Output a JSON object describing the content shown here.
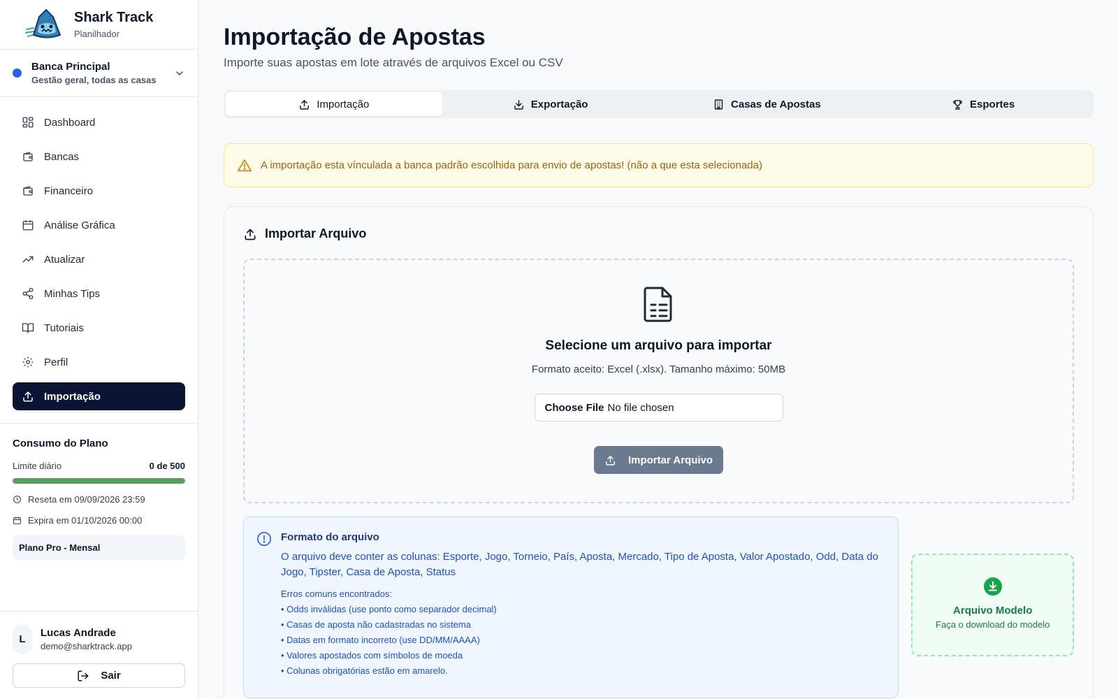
{
  "brand": {
    "title": "Shark Track",
    "subtitle": "Planilhador"
  },
  "bank": {
    "name": "Banca Principal",
    "description": "Gestão geral, todas as casas",
    "dot_color": "#2563eb"
  },
  "nav": [
    {
      "label": "Dashboard",
      "icon": "dashboard-grid-icon"
    },
    {
      "label": "Bancas",
      "icon": "wallet-icon"
    },
    {
      "label": "Financeiro",
      "icon": "wallet-icon"
    },
    {
      "label": "Análise Gráfica",
      "icon": "calendar-icon"
    },
    {
      "label": "Atualizar",
      "icon": "trending-up-icon"
    },
    {
      "label": "Minhas Tips",
      "icon": "share-icon"
    },
    {
      "label": "Tutoriais",
      "icon": "book-open-icon"
    },
    {
      "label": "Perfil",
      "icon": "gear-icon"
    },
    {
      "label": "Importação",
      "icon": "upload-icon",
      "active": true
    }
  ],
  "plan": {
    "title": "Consumo do Plano",
    "limit_label": "Limite diário",
    "limit_value": "0 de 500",
    "usage_fraction": 0,
    "bar_color": "#5b9e5b",
    "reset_text": "Reseta em 09/09/2026 23:59",
    "expire_text": "Expira em 01/10/2026 00:00",
    "plan_name": "Plano Pro - Mensal"
  },
  "user": {
    "initial": "L",
    "name": "Lucas Andrade",
    "email": "demo@sharktrack.app",
    "logout_label": "Sair"
  },
  "page": {
    "title": "Importação de Apostas",
    "subtitle": "Importe suas apostas em lote através de arquivos Excel ou CSV"
  },
  "tabs": [
    {
      "label": "Importação",
      "icon": "upload-icon",
      "active": true
    },
    {
      "label": "Exportação",
      "icon": "download-icon"
    },
    {
      "label": "Casas de Apostas",
      "icon": "building-icon"
    },
    {
      "label": "Esportes",
      "icon": "trophy-icon"
    }
  ],
  "alert": {
    "text": "A importação esta vínculada a banca padrão escolhida para envio de apostas! (não a que esta selecionada)"
  },
  "import_card": {
    "title": "Importar Arquivo",
    "drop_title": "Selecione um arquivo para importar",
    "drop_desc": "Formato aceito: Excel (.xlsx). Tamanho máximo: 50MB",
    "choose_label": "Choose File",
    "no_file_label": "No file chosen",
    "import_button": "Importar Arquivo"
  },
  "format": {
    "title": "Formato do arquivo",
    "columns_text": "O arquivo deve conter as colunas: Esporte, Jogo, Torneio, País, Aposta, Mercado, Tipo de Aposta, Valor Apostado, Odd, Data do Jogo, Tipster, Casa de Aposta, Status",
    "errors_title": "Erros comuns encontrados:",
    "errors": [
      "• Odds inválidas (use ponto como separador decimal)",
      "• Casas de aposta não cadastradas no sistema",
      "• Datas em formato incorreto (use DD/MM/AAAA)",
      "• Valores apostados com símbolos de moeda",
      "• Colunas obrigatórias estão em amarelo."
    ]
  },
  "model": {
    "title": "Arquivo Modelo",
    "subtitle": "Faça o download do modelo"
  }
}
